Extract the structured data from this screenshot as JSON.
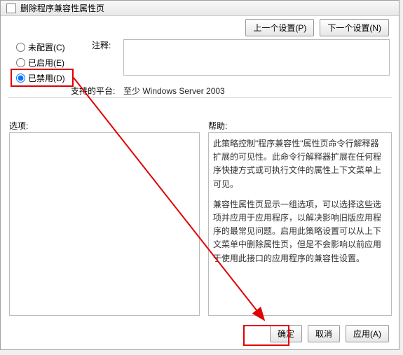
{
  "title": "删除程序兼容性属性页",
  "nav": {
    "prev": "上一个设置(P)",
    "next": "下一个设置(N)"
  },
  "radios": {
    "not_configured": "未配置(C)",
    "enabled": "已启用(E)",
    "disabled": "已禁用(D)"
  },
  "labels": {
    "comment": "注释:",
    "platform": "支持的平台:",
    "options": "选项:",
    "help": "帮助:"
  },
  "platform_value": "至少 Windows Server 2003",
  "help": {
    "p1": "此策略控制\"程序兼容性\"属性页命令行解释器扩展的可见性。此命令行解释器扩展在任何程序快捷方式或可执行文件的属性上下文菜单上可见。",
    "p2": "兼容性属性页显示一组选项，可以选择这些选项并应用于应用程序，以解决影响旧版应用程序的最常见问题。启用此策略设置可以从上下文菜单中删除属性页，但是不会影响以前应用于使用此接口的应用程序的兼容性设置。"
  },
  "buttons": {
    "ok": "确定",
    "cancel": "取消",
    "apply": "应用(A)"
  }
}
